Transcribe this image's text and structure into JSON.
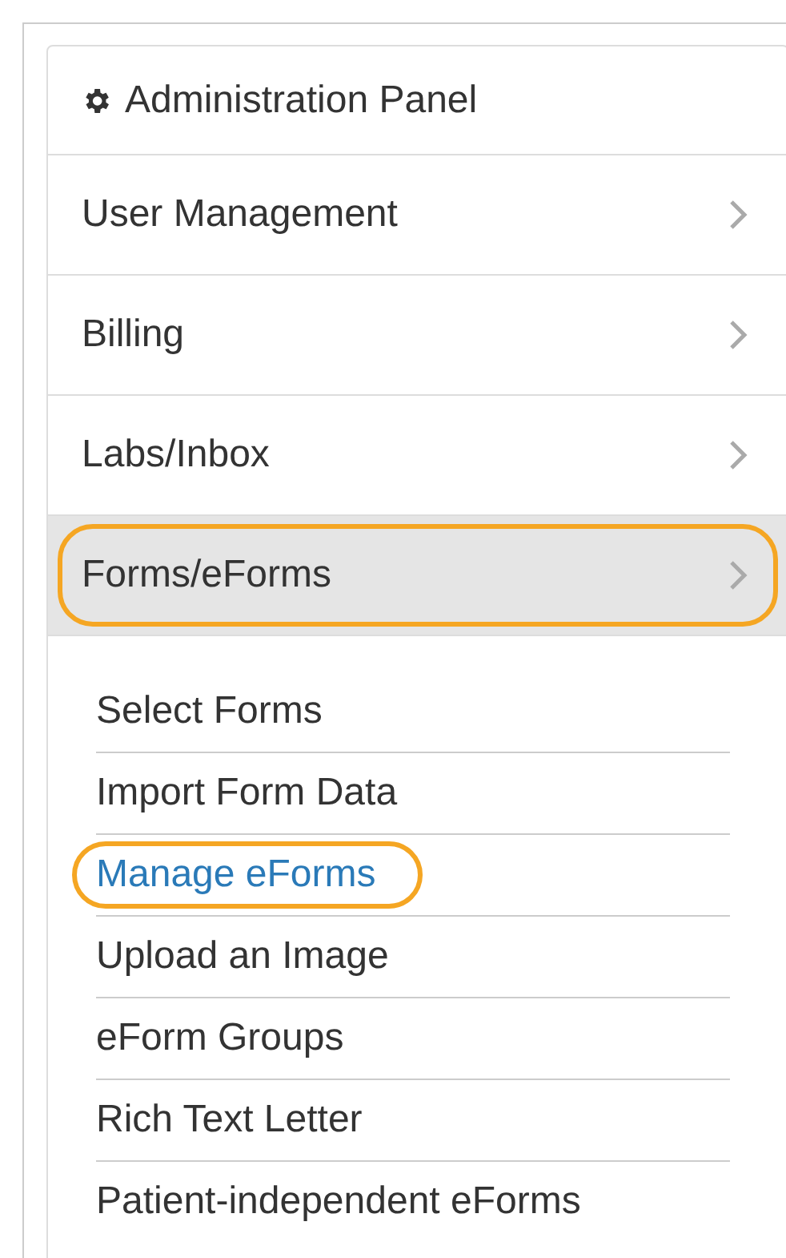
{
  "header": {
    "title": "Administration Panel"
  },
  "menu": [
    {
      "label": "User Management",
      "expanded": false,
      "highlighted": false
    },
    {
      "label": "Billing",
      "expanded": false,
      "highlighted": false
    },
    {
      "label": "Labs/Inbox",
      "expanded": false,
      "highlighted": false
    },
    {
      "label": "Forms/eForms",
      "expanded": true,
      "highlighted": true
    }
  ],
  "submenu": [
    {
      "label": "Select Forms",
      "selected": false,
      "highlighted": false
    },
    {
      "label": "Import Form Data",
      "selected": false,
      "highlighted": false
    },
    {
      "label": "Manage eForms",
      "selected": true,
      "highlighted": true
    },
    {
      "label": "Upload an Image",
      "selected": false,
      "highlighted": false
    },
    {
      "label": "eForm Groups",
      "selected": false,
      "highlighted": false
    },
    {
      "label": "Rich Text Letter",
      "selected": false,
      "highlighted": false
    },
    {
      "label": "Patient-independent eForms",
      "selected": false,
      "highlighted": false
    }
  ]
}
